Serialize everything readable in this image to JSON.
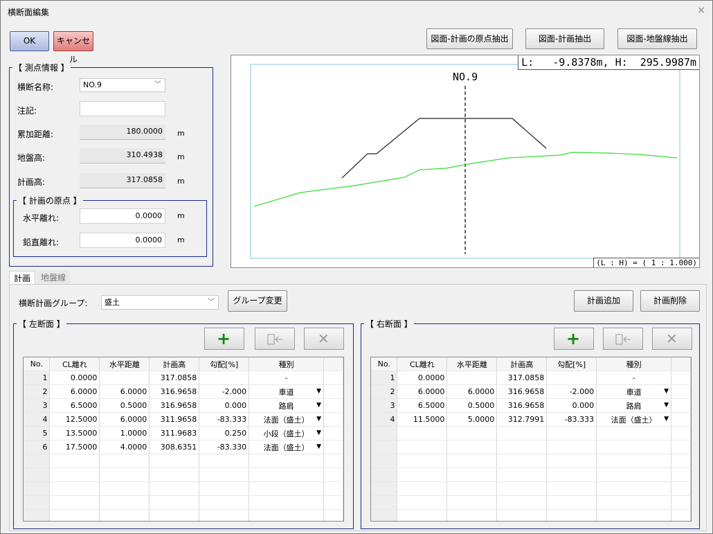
{
  "window": {
    "title": "横断面編集"
  },
  "buttons": {
    "ok": "OK",
    "cancel": "キャンセル",
    "extract_origin": "図面-計画の原点抽出",
    "extract_plan": "図面-計画抽出",
    "extract_ground": "図面-地盤線抽出",
    "group_change": "グループ変更",
    "add_plan": "計画追加",
    "delete_plan": "計画削除"
  },
  "survey": {
    "legend": "【 測点情報 】",
    "name_label": "横断名称:",
    "name_value": "NO.9",
    "note_label": "注記:",
    "note_value": "",
    "cum_label": "累加距離:",
    "cum_value": "180.0000",
    "ground_label": "地盤高:",
    "ground_value": "310.4938",
    "plan_label": "計画高:",
    "plan_value": "317.0858",
    "unit": "m"
  },
  "origin": {
    "legend": "【 計画の原点 】",
    "h_label": "水平離れ:",
    "h_value": "0.0000",
    "v_label": "鉛直離れ:",
    "v_value": "0.0000",
    "unit": "m"
  },
  "canvas": {
    "coord_readout": "L:   -9.8378m, H:  295.9987m",
    "station_label": "NO.9",
    "scale_readout": "(L : H) = ( 1 : 1.000)",
    "plan_color": "#222222",
    "ground_color": "#33dd33",
    "centerline_color": "#333333",
    "frame_color": "#7fc6e6"
  },
  "tabs": [
    {
      "label": "計画",
      "active": true
    },
    {
      "label": "地盤線",
      "active": false
    }
  ],
  "plan_group": {
    "label": "横断計画グループ:",
    "value": "盛土"
  },
  "left_section": {
    "legend": "【 左断面 】",
    "columns": [
      "No.",
      "CL離れ",
      "水平距離",
      "計画高",
      "勾配[%]",
      "種別"
    ],
    "rows": [
      [
        "1",
        "0.0000",
        "",
        "317.0858",
        "",
        "-"
      ],
      [
        "2",
        "6.0000",
        "6.0000",
        "316.9658",
        "-2.000",
        "車道"
      ],
      [
        "3",
        "6.5000",
        "0.5000",
        "316.9658",
        "0.000",
        "路肩"
      ],
      [
        "4",
        "12.5000",
        "6.0000",
        "311.9658",
        "-83.333",
        "法面（盛土）"
      ],
      [
        "5",
        "13.5000",
        "1.0000",
        "311.9683",
        "0.250",
        "小段（盛土）"
      ],
      [
        "6",
        "17.5000",
        "4.0000",
        "308.6351",
        "-83.330",
        "法面（盛土）"
      ]
    ]
  },
  "right_section": {
    "legend": "【 右断面 】",
    "columns": [
      "No.",
      "CL離れ",
      "水平距離",
      "計画高",
      "勾配[%]",
      "種別"
    ],
    "rows": [
      [
        "1",
        "0.0000",
        "",
        "317.0858",
        "",
        "-"
      ],
      [
        "2",
        "6.0000",
        "6.0000",
        "316.9658",
        "-2.000",
        "車道"
      ],
      [
        "3",
        "6.5000",
        "0.5000",
        "316.9658",
        "0.000",
        "路肩"
      ],
      [
        "4",
        "11.5000",
        "5.0000",
        "312.7991",
        "-83.333",
        "法面（盛土）"
      ]
    ]
  },
  "icons": {
    "add": "plus-icon",
    "insert": "insert-row-icon",
    "delete": "delete-x-icon"
  }
}
